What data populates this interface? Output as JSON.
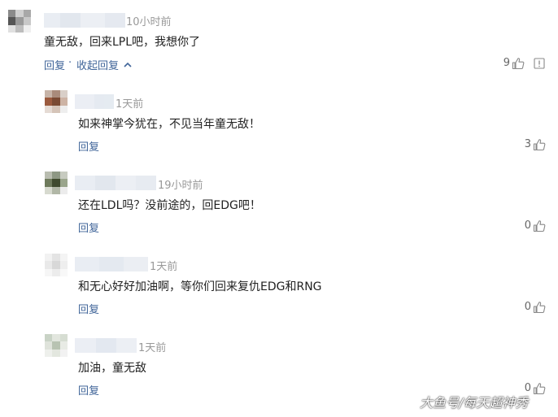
{
  "comments": [
    {
      "time": "10小时前",
      "text": "童无敌，回来LPL吧，我想你了",
      "reply_label": "回复",
      "separator": "·",
      "collapse_label": "收起回复",
      "likes": "9",
      "colors": {
        "avatar": [
          "#8a8a8a",
          "#d0d0d0",
          "#a8a8a8",
          "#555555",
          "#999999",
          "#c8c8c8",
          "#e0e0e0",
          "#bdbdbd",
          "#efefef"
        ]
      }
    },
    {
      "time": "1天前",
      "text": "如来神掌今犹在，不见当年童无敌！",
      "reply_label": "回复",
      "likes": "3",
      "colors": {
        "avatar": [
          "#c7b4a8",
          "#a98b7b",
          "#d9cfc8",
          "#9b5a3e",
          "#7a4a33",
          "#cdb3a4",
          "#e5dbd4",
          "#d5c4b8",
          "#eeeeee"
        ]
      }
    },
    {
      "time": "19小时前",
      "text": "还在LDL吗？没前途的，回EDG吧！",
      "reply_label": "回复",
      "likes": "0",
      "colors": {
        "avatar": [
          "#b9bdb0",
          "#8e9884",
          "#c7cbc0",
          "#6e7a5c",
          "#3f4a2e",
          "#9aa58c",
          "#d7dacf",
          "#b1b7a6",
          "#ececec"
        ]
      }
    },
    {
      "time": "1天前",
      "text": "和无心好好加油啊，等你们回来复仇EDG和RNG",
      "reply_label": "回复",
      "likes": "0",
      "colors": {
        "avatar": [
          "#f2f2f2",
          "#e4e4e4",
          "#f4f4f4",
          "#e9e9e9",
          "#d8d8d8",
          "#eeeeee",
          "#f6f6f6",
          "#ececec",
          "#f8f8f8"
        ]
      }
    },
    {
      "time": "1天前",
      "text": "加油，童无敌",
      "reply_label": "回复",
      "likes": "0",
      "colors": {
        "avatar": [
          "#c9d3c6",
          "#e2e6de",
          "#d6ddd2",
          "#dfe3db",
          "#b8c3b2",
          "#e8ebe5",
          "#eef0ec",
          "#e3e7df",
          "#f2f2f2"
        ]
      }
    }
  ],
  "colors": {
    "link": "#406599",
    "time": "#999999",
    "text": "#222222",
    "name_blur": "#e3e8f0"
  },
  "watermark": "大鱼号/每天超神秀"
}
